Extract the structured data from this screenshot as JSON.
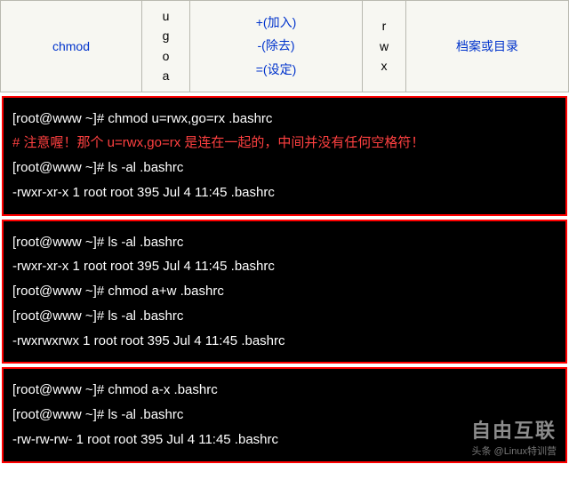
{
  "table": {
    "cmd": "chmod",
    "who": [
      "u",
      "g",
      "o",
      "a"
    ],
    "ops": [
      "+(加入)",
      "-(除去)",
      "=(设定)"
    ],
    "rwx": [
      "r",
      "w",
      "x"
    ],
    "target": "档案或目录"
  },
  "terminal1": {
    "l1": "[root@www ~]# chmod  u=rwx,go=rx  .bashrc",
    "l2": "# 注意喔！那个 u=rwx,go=rx 是连在一起的，中间并没有任何空格符！",
    "l3": "[root@www ~]# ls -al .bashrc",
    "l4": "-rwxr-xr-x  1 root root 395 Jul  4 11:45 .bashrc"
  },
  "terminal2": {
    "l1": "[root@www ~]# ls -al .bashrc",
    "l2": "-rwxr-xr-x  1 root root 395 Jul  4 11:45 .bashrc",
    "l3": "[root@www ~]# chmod  a+w  .bashrc",
    "l4": "[root@www ~]# ls -al .bashrc",
    "l5": "-rwxrwxrwx  1 root root 395 Jul  4 11:45 .bashrc"
  },
  "terminal3": {
    "l1": "[root@www ~]# chmod  a-x  .bashrc",
    "l2": "[root@www ~]# ls -al .bashrc",
    "l3": "-rw-rw-rw-  1 root root 395 Jul  4 11:45 .bashrc"
  },
  "watermark": {
    "big": "自由互联",
    "small": "头条 @Linux特训营"
  }
}
